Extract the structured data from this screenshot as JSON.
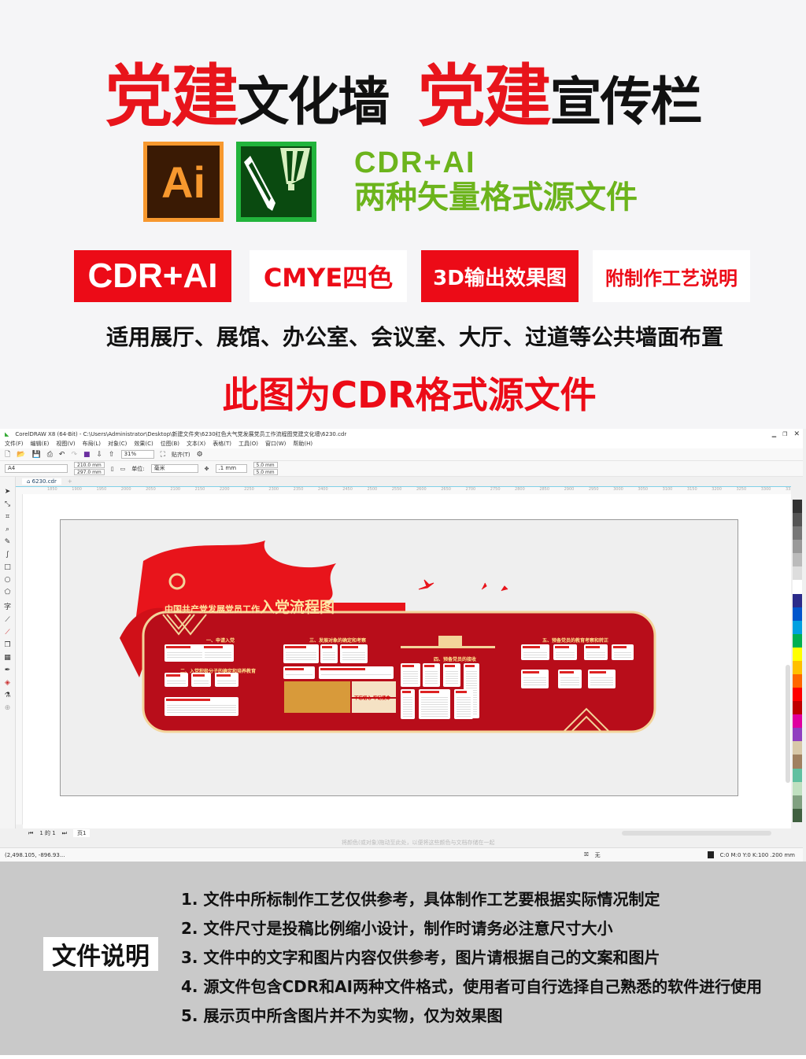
{
  "header": {
    "title_parts": [
      {
        "text": "党建",
        "color": "#e8141b"
      },
      {
        "text": "文化墙",
        "color": "#111111"
      },
      {
        "text": "党建",
        "color": "#e8141b"
      },
      {
        "text": "宣传栏",
        "color": "#111111"
      }
    ]
  },
  "logos": {
    "ai": "Ai",
    "cdr": "coreldraw-balloon-pen-icon"
  },
  "formats": {
    "line1": "CDR+AI",
    "line2": "两种矢量格式源文件",
    "color": "#6cb41c"
  },
  "badges": [
    {
      "label": "CDR+AI",
      "style": "red"
    },
    {
      "label": "CMYE四色",
      "style": "white"
    },
    {
      "label": "3D输出效果图",
      "style": "red"
    },
    {
      "label": "附制作工艺说明",
      "style": "white"
    }
  ],
  "usage": "适用展厅、展馆、办公室、会议室、大厅、过道等公共墙面布置",
  "cdr_note": "此图为CDR格式源文件",
  "app": {
    "title": "CorelDRAW X8 (64-Bit) - C:\\Users\\Administrator\\Desktop\\新建文件夹\\6230红色大气党发展党员工作流程图党建文化墙\\6230.cdr",
    "menu": [
      "文件(F)",
      "编辑(E)",
      "视图(V)",
      "布局(L)",
      "对象(C)",
      "效果(C)",
      "位图(B)",
      "文本(X)",
      "表格(T)",
      "工具(O)",
      "窗口(W)",
      "帮助(H)"
    ],
    "zoom": "31%",
    "snap": "贴齐(T)",
    "page_size": "A4",
    "width": "210.0 mm",
    "height": "297.0 mm",
    "unit_label": "单位:",
    "unit": "毫米",
    "nudge": ".1 mm",
    "dup_x": "5.0 mm",
    "dup_y": "5.0 mm",
    "doc_tab": "6230.cdr",
    "ruler": [
      "1850",
      "1900",
      "1950",
      "2000",
      "2050",
      "2100",
      "2150",
      "2200",
      "2250",
      "2300",
      "2350",
      "2400",
      "2450",
      "2500",
      "2550",
      "2600",
      "2650",
      "2700",
      "2750",
      "2800",
      "2850",
      "2900",
      "2950",
      "3000",
      "3050",
      "3100",
      "3150",
      "3200",
      "3250",
      "3300",
      "3350"
    ],
    "page_nav": "1 的 1",
    "page_tab": "页1",
    "hint": "将颜色(或对象)拖动至此处，以便将这些颜色与文档存储在一起",
    "coords": "(2,498.105, -896.93...",
    "fill": "无",
    "outline": "C:0 M:0 Y:0 K:100  .200 mm",
    "palette": [
      "#333333",
      "#555555",
      "#777777",
      "#999999",
      "#bbbbbb",
      "#dddddd",
      "#ffffff",
      "#2b2b8a",
      "#0055cc",
      "#00a0e0",
      "#00b050",
      "#ffff00",
      "#ffc000",
      "#ff6600",
      "#ff0000",
      "#c00000",
      "#e000a0",
      "#9040c0",
      "#d8c8a8",
      "#a08060",
      "#60c0a0",
      "#c0e0c0",
      "#80a080",
      "#406040"
    ]
  },
  "artwork": {
    "title_small": "中国共产党发展党员工作",
    "title_big": "入党流程图",
    "sections": [
      "一、申请入党",
      "二、入党积极分子的确定和培养教育",
      "三、发展对象的确定和考察",
      "四、预备党员的接收",
      "五、预备党员的教育考察和转正"
    ],
    "slogan": "不忘初心 牢记使命"
  },
  "notes": {
    "label": "文件说明",
    "items": [
      "1. 文件中所标制作工艺仅供参考，具体制作工艺要根据实际情况制定",
      "2. 文件尺寸是投稿比例缩小设计，制作时请务必注意尺寸大小",
      "3. 文件中的文字和图片内容仅供参考，图片请根据自己的文案和图片",
      "4. 源文件包含CDR和AI两种文件格式，使用者可自行选择自己熟悉的软件进行使用",
      "5. 展示页中所含图片并不为实物，仅为效果图"
    ]
  }
}
